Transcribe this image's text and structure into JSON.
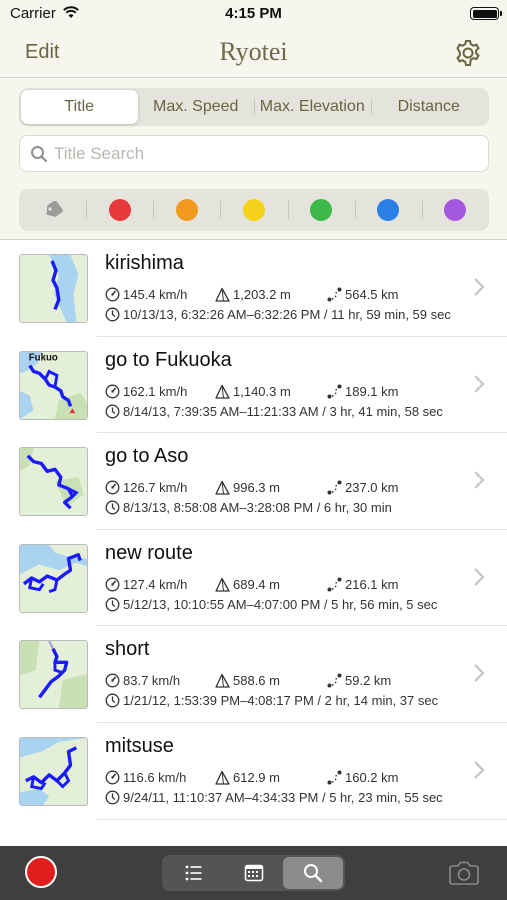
{
  "status_bar": {
    "carrier": "Carrier",
    "time": "4:15 PM"
  },
  "nav": {
    "edit_label": "Edit",
    "title": "Ryotei"
  },
  "sort_tabs": [
    {
      "label": "Title",
      "active": true
    },
    {
      "label": "Max. Speed",
      "active": false
    },
    {
      "label": "Max. Elevation",
      "active": false
    },
    {
      "label": "Distance",
      "active": false
    }
  ],
  "search": {
    "placeholder": "Title Search",
    "value": ""
  },
  "color_filters": [
    {
      "name": "red",
      "color": "#e8393c"
    },
    {
      "name": "orange",
      "color": "#f29a1d"
    },
    {
      "name": "yellow",
      "color": "#f7d21a"
    },
    {
      "name": "green",
      "color": "#3cb94a"
    },
    {
      "name": "blue",
      "color": "#2a7fe6"
    },
    {
      "name": "purple",
      "color": "#a458e0"
    }
  ],
  "routes": [
    {
      "name": "kirishima",
      "max_speed": "145.4 km/h",
      "max_elevation": "1,203.2 m",
      "distance": "564.5 km",
      "time": "10/13/13, 6:32:26 AM–6:32:26 PM / 11 hr, 59 min, 59 sec"
    },
    {
      "name": "go to Fukuoka",
      "max_speed": "162.1 km/h",
      "max_elevation": "1,140.3 m",
      "distance": "189.1 km",
      "time": "8/14/13, 7:39:35 AM–11:21:33 AM / 3 hr, 41 min, 58 sec",
      "map_label": "Fukuo"
    },
    {
      "name": "go to Aso",
      "max_speed": "126.7 km/h",
      "max_elevation": "996.3 m",
      "distance": "237.0 km",
      "time": "8/13/13, 8:58:08 AM–3:28:08 PM / 6 hr, 30 min"
    },
    {
      "name": "new route",
      "max_speed": "127.4 km/h",
      "max_elevation": "689.4 m",
      "distance": "216.1 km",
      "time": "5/12/13, 10:10:55 AM–4:07:00 PM / 5 hr, 56 min, 5 sec"
    },
    {
      "name": "short",
      "max_speed": "83.7 km/h",
      "max_elevation": "588.6 m",
      "distance": "59.2 km",
      "time": "1/21/12, 1:53:39 PM–4:08:17 PM / 2 hr, 14 min, 37 sec"
    },
    {
      "name": "mitsuse",
      "max_speed": "116.6 km/h",
      "max_elevation": "612.9 m",
      "distance": "160.2 km",
      "time": "9/24/11, 11:10:37 AM–4:34:33 PM / 5 hr, 23 min, 55 sec"
    }
  ],
  "toolbar": {
    "active_view": "search",
    "record_color": "#e11d1d"
  },
  "colors": {
    "accent": "#6a6540",
    "bar_bg": "#f6f5ee",
    "route_line": "#1a1aff",
    "toolbar_bg": "#3f3f3f"
  }
}
